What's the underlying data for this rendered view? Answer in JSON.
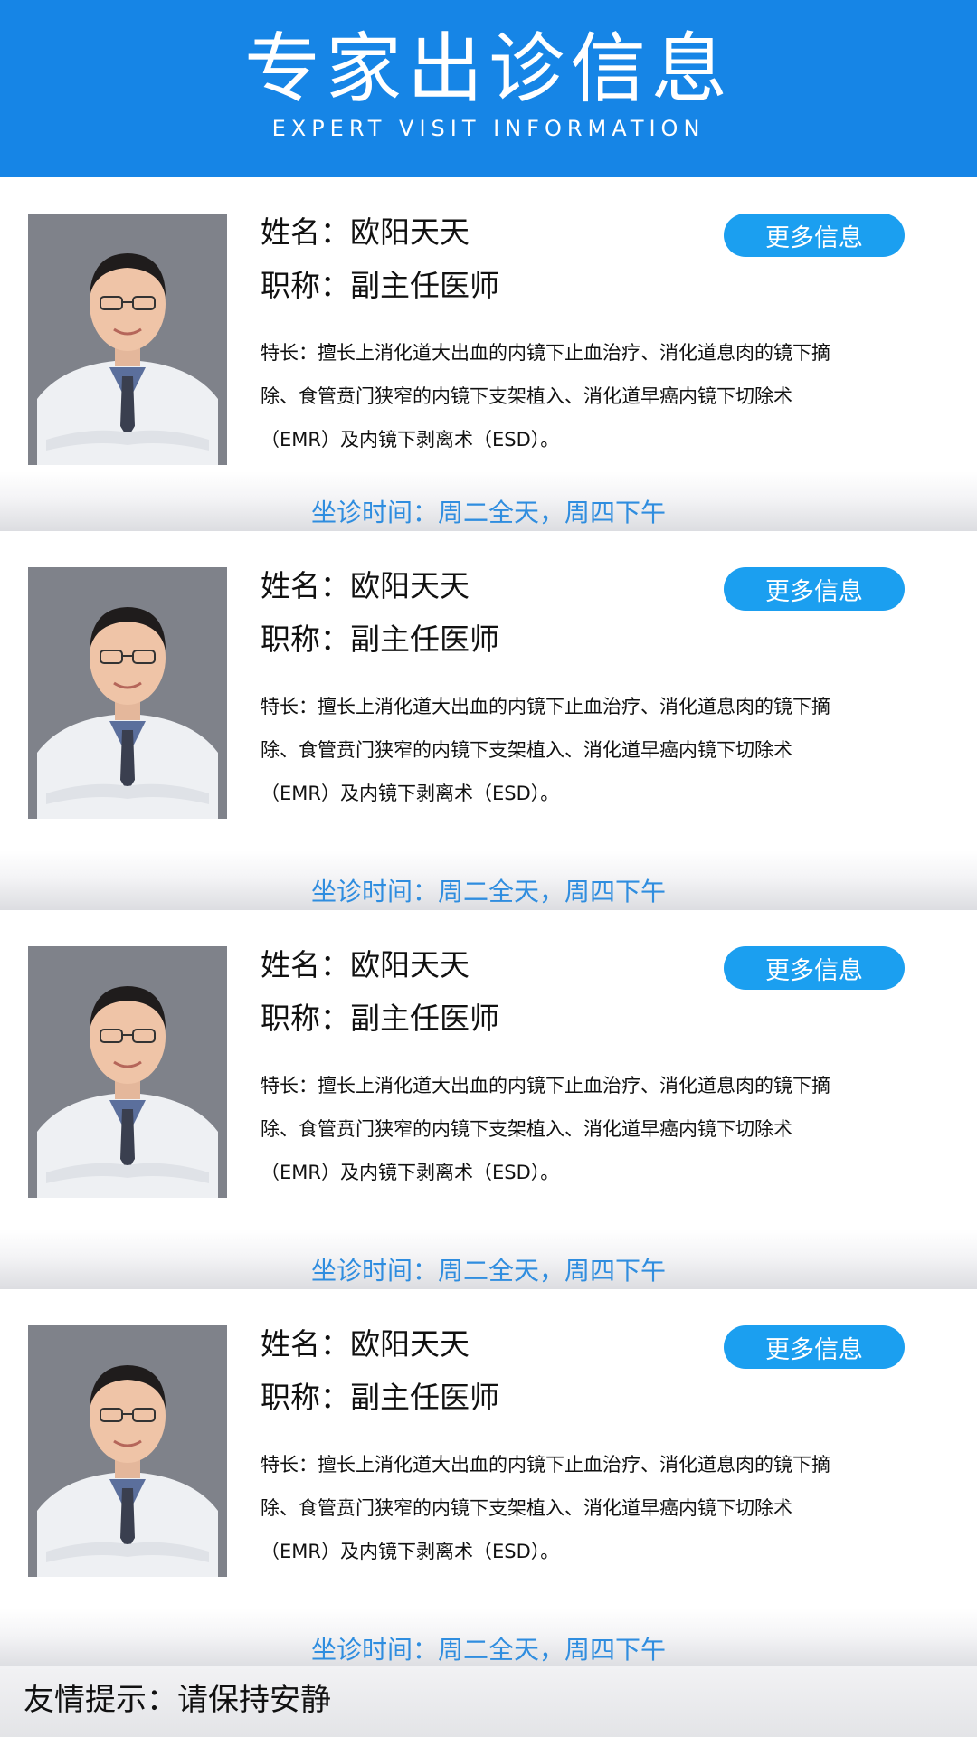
{
  "header": {
    "title": "专家出诊信息",
    "subtitle": "EXPERT VISIT INFORMATION",
    "background": "#1685e6"
  },
  "doctors": [
    {
      "name": "姓名：欧阳天天",
      "title": "职称：副主任医师",
      "more_label": "更多信息",
      "specialty": "特长：擅长上消化道大出血的内镜下止血治疗、消化道息肉的镜下摘除、食管贲门狭窄的内镜下支架植入、消化道早癌内镜下切除术（EMR）及内镜下剥离术（ESD）。",
      "schedule": "坐诊时间：周二全天，周四下午"
    },
    {
      "name": "姓名：欧阳天天",
      "title": "职称：副主任医师",
      "more_label": "更多信息",
      "specialty": "特长：擅长上消化道大出血的内镜下止血治疗、消化道息肉的镜下摘除、食管贲门狭窄的内镜下支架植入、消化道早癌内镜下切除术（EMR）及内镜下剥离术（ESD）。",
      "schedule": "坐诊时间：周二全天，周四下午"
    },
    {
      "name": "姓名：欧阳天天",
      "title": "职称：副主任医师",
      "more_label": "更多信息",
      "specialty": "特长：擅长上消化道大出血的内镜下止血治疗、消化道息肉的镜下摘除、食管贲门狭窄的内镜下支架植入、消化道早癌内镜下切除术（EMR）及内镜下剥离术（ESD）。",
      "schedule": "坐诊时间：周二全天，周四下午"
    },
    {
      "name": "姓名：欧阳天天",
      "title": "职称：副主任医师",
      "more_label": "更多信息",
      "specialty": "特长：擅长上消化道大出血的内镜下止血治疗、消化道息肉的镜下摘除、食管贲门狭窄的内镜下支架植入、消化道早癌内镜下切除术（EMR）及内镜下剥离术（ESD）。",
      "schedule": "坐诊时间：周二全天，周四下午"
    }
  ],
  "footer": {
    "tip": "友情提示：请保持安静"
  },
  "colors": {
    "accent": "#1b9ff0",
    "schedule_text": "#2f8ddf"
  }
}
